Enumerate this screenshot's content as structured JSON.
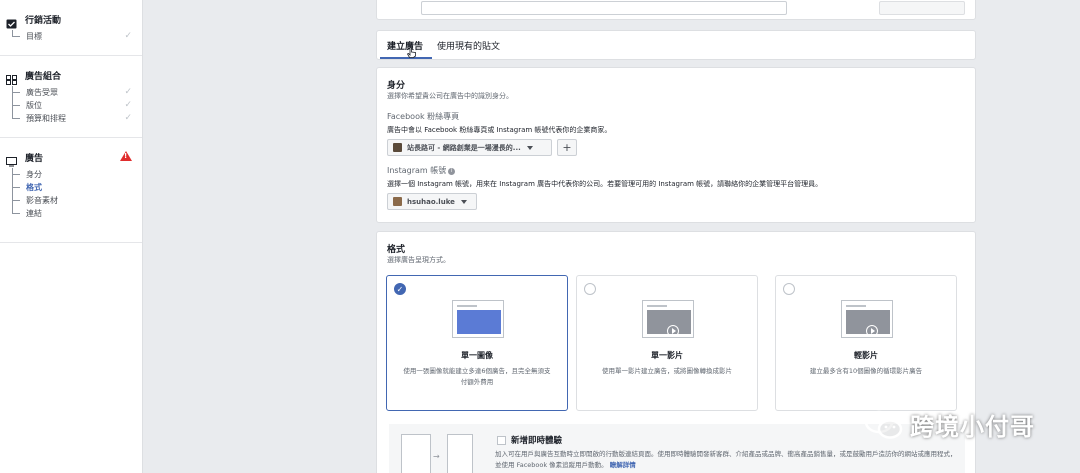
{
  "sidebar": {
    "campaign": {
      "label": "行銷活動",
      "items": [
        {
          "label": "目標",
          "done": true
        }
      ]
    },
    "adset": {
      "label": "廣告組合",
      "items": [
        {
          "label": "廣告受眾",
          "done": true
        },
        {
          "label": "版位",
          "done": true
        },
        {
          "label": "預算和排程",
          "done": true
        }
      ]
    },
    "ad": {
      "label": "廣告",
      "items": [
        {
          "label": "身分"
        },
        {
          "label": "格式",
          "active": true
        },
        {
          "label": "影音素材"
        },
        {
          "label": "連結"
        }
      ]
    },
    "check_glyph": "✓"
  },
  "tabs": {
    "create": "建立廣告",
    "existing": "使用現有的貼文"
  },
  "identity": {
    "title": "身分",
    "desc": "選擇你希望貴公司在廣告中的識別身分。",
    "fb_title": "Facebook 粉絲專頁",
    "fb_desc": "廣告中會以 Facebook 粉絲專頁或 Instagram 帳號代表你的企業商家。",
    "fb_page": "站長路可 - 網路創業是一場漫長的...",
    "plus": "+",
    "ig_title": "Instagram 帳號",
    "ig_desc": "選擇一個 Instagram 帳號，用來在 Instagram 廣告中代表你的公司。若要管理可用的 Instagram 帳號，請聯絡你的企業管理平台管理員。",
    "ig_account": "hsuhao.luke"
  },
  "format": {
    "title": "格式",
    "desc": "選擇廣告呈現方式。",
    "cards": [
      {
        "title": "單一圖像",
        "desc": "使用一張圖像就能建立多達6個廣告，且完全無須支付額外費用"
      },
      {
        "title": "單一影片",
        "desc": "使用單一影片建立廣告，或將圖像轉換成影片"
      },
      {
        "title": "輕影片",
        "desc": "建立最多含有10個圖像的循環影片廣告"
      }
    ],
    "selected_glyph": "✓",
    "instant": {
      "title": "新增即時體驗",
      "desc": "加入可在用戶與廣告互動時立即開啟的行動版連結頁面。使用即時體驗開發新客群、介紹產品或品牌、衝高產品銷售量，或是鼓勵用戶造訪你的網站或應用程式，並使用 Facebook 像素追蹤用戶動動。",
      "link": "瞭解詳情"
    }
  },
  "watermark": "跨境小付哥",
  "colors": {
    "accent": "#4267b2",
    "warning": "#e02d2d"
  }
}
